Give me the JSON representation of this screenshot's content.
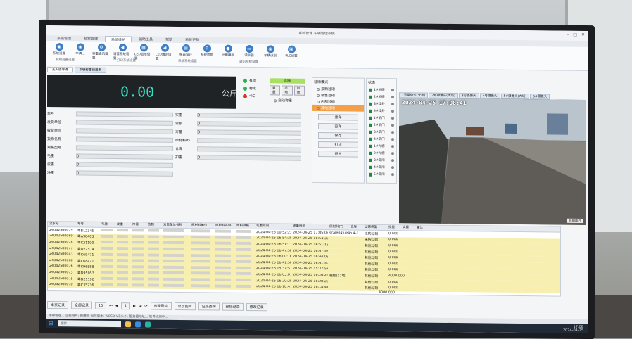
{
  "window": {
    "title": "系统管理 车辆管理系统"
  },
  "menu_tabs": [
    {
      "label": "系统管理",
      "active": false
    },
    {
      "label": "档案管理",
      "active": false
    },
    {
      "label": "系统维护",
      "active": true
    },
    {
      "label": "辅助工具",
      "active": false
    },
    {
      "label": "帮助",
      "active": false
    },
    {
      "label": "系统更新",
      "active": false
    }
  ],
  "ribbon": {
    "groups": [
      "系统设备设置",
      "打印系统设置",
      "系统系统设置",
      "通讯系统设置"
    ],
    "buttons": [
      {
        "label": "系统设置",
        "icon": "camera-icon"
      },
      {
        "label": "车牌...",
        "icon": "camera-icon"
      },
      {
        "label": "称重通讯设置",
        "icon": "gear-icon"
      },
      {
        "label": "语音系统设置",
        "icon": "speaker-icon"
      },
      {
        "label": "LED显示设置",
        "icon": "display-icon"
      },
      {
        "label": "LED通讯设置",
        "icon": "speaker-icon"
      },
      {
        "label": "报表设计",
        "icon": "report-icon"
      },
      {
        "label": "系统权限",
        "icon": "gear-icon"
      },
      {
        "label": "计量模板",
        "icon": "user-icon"
      },
      {
        "label": "读卡器",
        "icon": "card-icon"
      },
      {
        "label": "车辆识别",
        "icon": "camera-icon"
      },
      {
        "label": "PLC设置",
        "icon": "monitor-icon"
      }
    ]
  },
  "doc_tabs": [
    "无人值守磅",
    "车辆称重磅报表"
  ],
  "weighing": {
    "value": "0.00",
    "unit": "公斤"
  },
  "indicators": [
    {
      "label": "有磅",
      "color": "#29b34a"
    },
    {
      "label": "稳定",
      "color": "#29b34a"
    },
    {
      "label": "卡C",
      "color": "#d9322a"
    }
  ],
  "status": {
    "label": "连接",
    "buttons": [
      "重量",
      "手动",
      "自动"
    ],
    "auto_label": "自动称重"
  },
  "form": {
    "labels_left": [
      "车号",
      "发货单位",
      "收货单位",
      "货物名称",
      "规格型号",
      "毛重",
      "皮重",
      "净重"
    ],
    "values_left": [
      "",
      "",
      "",
      "",
      "",
      "0",
      "0",
      "0"
    ],
    "labels_right": [
      "实重",
      "金额",
      "方量",
      "原材料(t)",
      "仓库",
      "扣重"
    ],
    "values_right": [
      "0",
      "0",
      "0",
      "",
      "",
      "0"
    ]
  },
  "mode_panel": {
    "title": "过磅模式",
    "modes": [
      {
        "label": "采购过磅",
        "selected": false
      },
      {
        "label": "销售过磅",
        "selected": false
      },
      {
        "label": "内部过磅",
        "selected": false
      },
      {
        "label": "其他过磅",
        "selected": true
      }
    ],
    "actions": [
      "重车",
      "空车",
      "保存",
      "打印",
      "退出"
    ]
  },
  "sensor_panel": {
    "title": "状态",
    "items": [
      "1#地磅",
      "2#地磅",
      "3#红外",
      "4#红外",
      "1#前门",
      "2#前门",
      "3#后门",
      "4#后门",
      "1#光栅",
      "2#光栅",
      "3#道闸",
      "4#道闸",
      "5#道闸"
    ]
  },
  "camera": {
    "tabs": [
      "1号摄像头(大场)",
      "2号摄像头(大场)",
      "3号摄像头",
      "4号摄像头",
      "5#摄像头(大场)",
      "6#摄像头"
    ],
    "timestamp": "2024-04-25 17:08:41",
    "corner_label": "抓拍图片"
  },
  "table": {
    "columns": [
      "流水号",
      "车号",
      "毛重",
      "皮重",
      "净重",
      "货物",
      "发货单位名称",
      "原材料单位",
      "原材料名称",
      "原料规格",
      "毛重时间",
      "皮重时间",
      "原材料(T)",
      "仓库",
      "过磅类型",
      "扣重",
      "实重",
      "备注"
    ],
    "rows": [
      {
        "serial": "24042500079",
        "plate": "粤B12345",
        "gross_time": "2024-04-25 10:52:23",
        "tare_time": "2024-04-25 17:05:03",
        "remark": "scale04fue45 4-1",
        "type": "采购过磅",
        "net": "0.000",
        "hl": false
      },
      {
        "serial": "24042500080",
        "plate": "粤A98403",
        "gross_time": "2024-04-25 16:54:39",
        "tare_time": "2024-04-25 16:54:39",
        "remark": "",
        "type": "采购过磅",
        "net": "0.000",
        "hl": true
      },
      {
        "serial": "24042500078",
        "plate": "粤C21190",
        "gross_time": "2024-04-25 16:51:13",
        "tare_time": "2024-04-25 16:51:13",
        "remark": "",
        "type": "其他过磅",
        "net": "0.000",
        "hl": true
      },
      {
        "serial": "24042500077",
        "plate": "粤D22514",
        "gross_time": "2024-04-25 16:47:58",
        "tare_time": "2024-04-25 16:47:58",
        "remark": "",
        "type": "其他过磅",
        "net": "0.000",
        "hl": true
      },
      {
        "serial": "24042500043",
        "plate": "粤C69471",
        "gross_time": "2024-04-25 16:00:16",
        "tare_time": "2024-04-25 16:44:08",
        "remark": "",
        "type": "其他过磅",
        "net": "0.000",
        "hl": true
      },
      {
        "serial": "24042500068",
        "plate": "粤C68471",
        "gross_time": "2024-04-25 16:41:50",
        "tare_time": "2024-04-25 16:41:50",
        "remark": "",
        "type": "其他过磅",
        "net": "0.000",
        "hl": true
      },
      {
        "serial": "24042500076",
        "plate": "粤C96858",
        "gross_time": "2024-04-25 15:37:57",
        "tare_time": "2024-04-25 15:37:57",
        "remark": "",
        "type": "其他过磅",
        "net": "0.000",
        "hl": true
      },
      {
        "serial": "24042500073",
        "plate": "粤D95053",
        "gross_time": "2024-04-25 16:03:07",
        "tare_time": "2024-04-25 16:26:26",
        "remark": "载板(17吨)",
        "type": "其他过磅",
        "net": "4000.000",
        "hl": true
      },
      {
        "serial": "24042500075",
        "plate": "粤D21190",
        "gross_time": "2024-04-25 16:20:20",
        "tare_time": "2024-04-25 16:20:20",
        "remark": "",
        "type": "其他过磅",
        "net": "0.000",
        "hl": true
      },
      {
        "serial": "24042500070",
        "plate": "粤C35236",
        "gross_time": "2024-04-25 16:18:47",
        "tare_time": "2024-04-25 16:18:47",
        "remark": "",
        "type": "其他过磅",
        "net": "0.000",
        "hl": true
      }
    ],
    "footer_total": "4000.000"
  },
  "pager": {
    "scope": "本页记录",
    "filter": "全部记录",
    "page_size": "15",
    "page": "1",
    "buttons": [
      "出磅图片",
      "显示图片",
      "记录查询",
      "删除记录",
      "修改记录"
    ]
  },
  "statusbar": "地磅管理...  当前用户: 管理员   当前版本: WBSD V3.5.21   服务器地址...  软件检测中...",
  "taskbar": {
    "search": "搜索",
    "time": "17:08",
    "date": "2024-04-25"
  }
}
